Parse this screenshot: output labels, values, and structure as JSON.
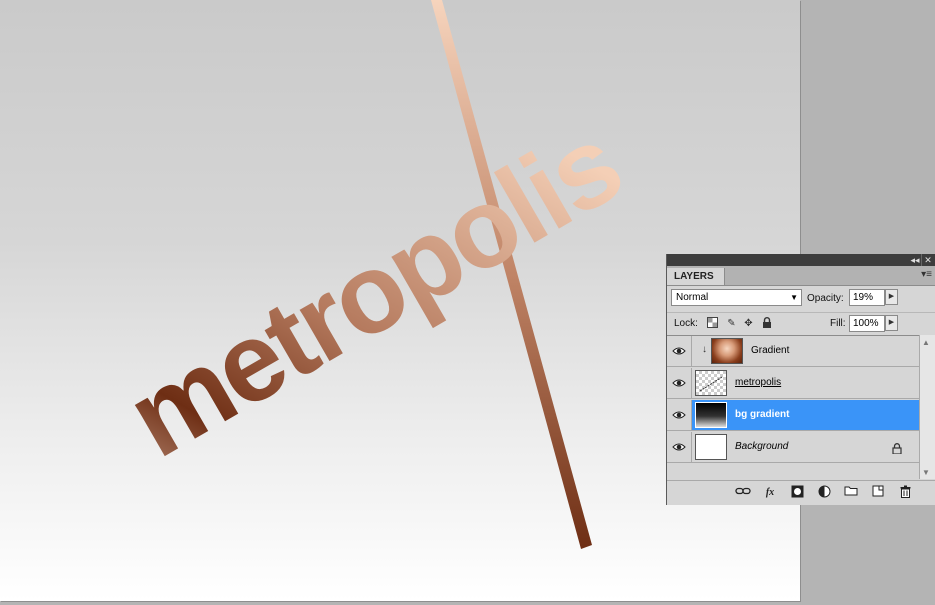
{
  "artwork": {
    "text": "metropolis"
  },
  "colors": {
    "copper_dark": "#6e2e14",
    "copper_mid": "#a8674a",
    "copper_light": "#f4cfb6",
    "selection": "#3a94f8"
  },
  "panel": {
    "tab_label": "LAYERS",
    "collapse_icon": "double-chevron-icon",
    "close_icon": "close-icon",
    "menu_icon": "panel-menu-icon",
    "blend_mode": "Normal",
    "opacity_label": "Opacity:",
    "opacity_value": "19%",
    "lock_label": "Lock:",
    "fill_label": "Fill:",
    "fill_value": "100%",
    "layers": [
      {
        "name": "Gradient",
        "clipped": true,
        "selected": false
      },
      {
        "name": "metropolis",
        "underlined": true,
        "selected": false
      },
      {
        "name": "bg gradient",
        "selected": true
      },
      {
        "name": "Background",
        "italic": true,
        "locked": true,
        "selected": false
      }
    ],
    "footer_icons": [
      "link-layers-icon",
      "fx-icon",
      "add-mask-icon",
      "adjustment-layer-icon",
      "new-group-icon",
      "new-layer-icon",
      "trash-icon"
    ]
  }
}
